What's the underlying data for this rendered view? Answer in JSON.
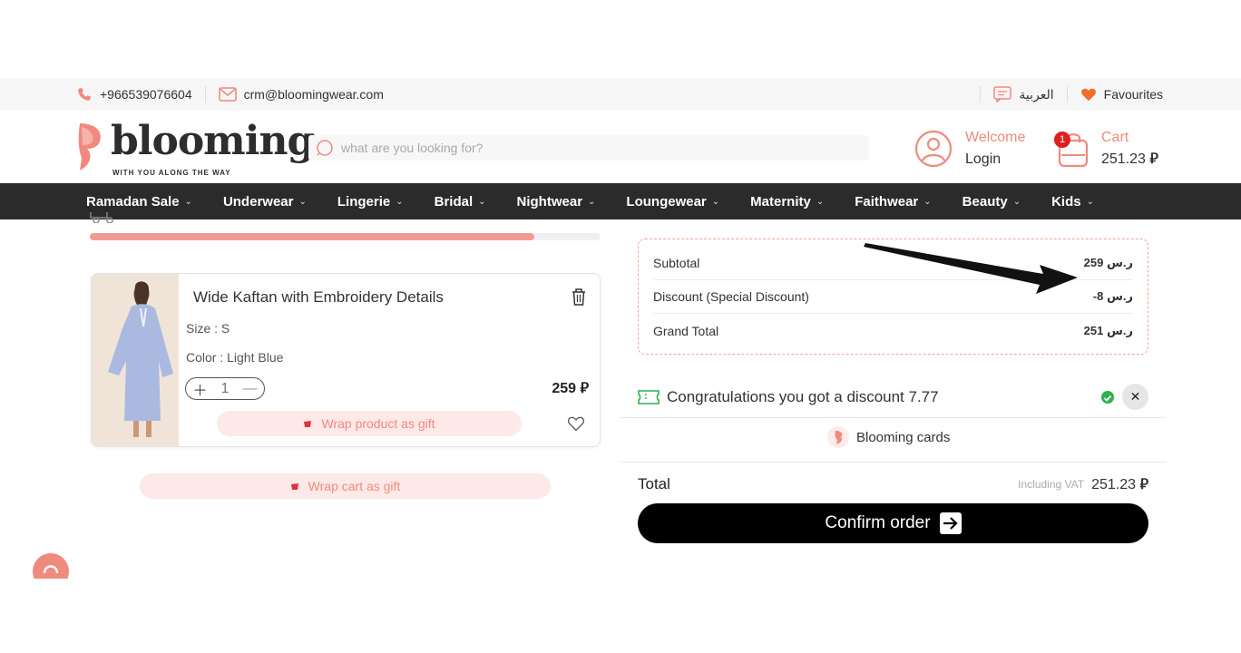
{
  "topbar": {
    "phone": "+966539076604",
    "email": "crm@bloomingwear.com",
    "language": "العربية",
    "favourites": "Favourites"
  },
  "header": {
    "logo_text": "blooming",
    "logo_tagline": "WITH YOU ALONG THE WAY",
    "search_placeholder": "what are you looking for?",
    "welcome": "Welcome",
    "login": "Login",
    "cart_label": "Cart",
    "cart_count": "1",
    "cart_amount": "251.23"
  },
  "nav": {
    "items": [
      "Ramadan Sale",
      "Underwear",
      "Lingerie",
      "Bridal",
      "Nightwear",
      "Loungewear",
      "Maternity",
      "Faithwear",
      "Beauty",
      "Kids"
    ]
  },
  "cart": {
    "progress": 0.87,
    "item": {
      "name": "Wide Kaftan with Embroidery Details",
      "size": "Size : S",
      "color": "Color : Light Blue",
      "quantity": "1",
      "price": "259",
      "wrap_product": "Wrap product as gift"
    },
    "wrap_cart": "Wrap cart as gift"
  },
  "summary": {
    "subtotal_label": "Subtotal",
    "subtotal_value": "259 ر.س",
    "discount_label": "Discount (Special Discount)",
    "discount_value": "-8 ر.س",
    "grand_total_label": "Grand Total",
    "grand_total_value": "251 ر.س"
  },
  "discount_banner": {
    "text": "Congratulations you got a discount 7.77"
  },
  "blooming_cards": "Blooming cards",
  "total": {
    "label": "Total",
    "vat": "Including VAT",
    "amount": "251.23"
  },
  "confirm_label": "Confirm order",
  "colors": {
    "accent": "#f08a7e",
    "nav_bg": "#2b2b2b",
    "badge": "#e01e1e",
    "success": "#2bb24c"
  }
}
